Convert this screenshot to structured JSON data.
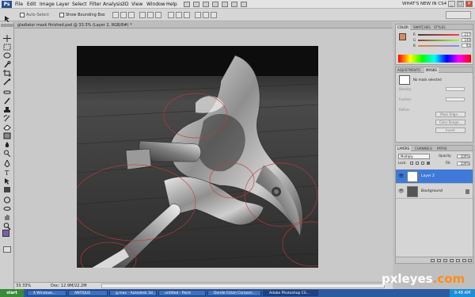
{
  "menubar": {
    "app_logo": "Ps",
    "items": [
      "File",
      "Edit",
      "Image",
      "Layer",
      "Select",
      "Filter",
      "Analysis",
      "3D",
      "View",
      "Window",
      "Help"
    ],
    "whats_new": "WHAT'S NEW IN CS4"
  },
  "options_bar": {
    "auto_select_label": "Auto-Select",
    "show_bounding_box_label": "Show Bounding Box"
  },
  "document": {
    "tab_title": "gladiator mask finished.psd @ 33.3% (Layer 2, RGB/8#) *",
    "zoom": "33.33%",
    "doc_size": "Doc: 12.9M/22.2M"
  },
  "color_panel": {
    "tabs": [
      "COLOR",
      "SWATCHES",
      "STYLES"
    ],
    "channels": [
      {
        "label": "R",
        "value": "217",
        "color": "#e24b4b"
      },
      {
        "label": "G",
        "value": "140",
        "color": "#47b24a"
      },
      {
        "label": "B",
        "value": "92",
        "color": "#3b62d6"
      }
    ]
  },
  "masks_panel": {
    "tabs": [
      "ADJUSTMENTS",
      "MASKS"
    ],
    "no_mask": "No mask selected",
    "density_label": "Density:",
    "feather_label": "Feather:",
    "refine_label": "Refine:",
    "mask_edge": "Mask Edge...",
    "color_range": "Color Range...",
    "invert": "Invert"
  },
  "layers_panel": {
    "tabs": [
      "LAYERS",
      "CHANNELS",
      "PATHS"
    ],
    "blend_mode": "Multiply",
    "opacity_label": "Opacity:",
    "opacity": "100%",
    "fill_label": "Fill:",
    "fill": "100%",
    "lock_label": "Lock:",
    "layers": [
      {
        "name": "Layer 2",
        "selected": true
      },
      {
        "name": "Background",
        "selected": false
      }
    ]
  },
  "taskbar": {
    "start": "start",
    "tasks": [
      "4 Windows...",
      "ANTIQUE",
      "g.max - Autodesk 3d...",
      "untitled - Paint",
      "Donde Estan Corazon...",
      "Adobe Photoshop CS..."
    ],
    "clock": "9:48 AM"
  },
  "watermark": {
    "text": "pxleyes",
    "suffix": ".com"
  }
}
